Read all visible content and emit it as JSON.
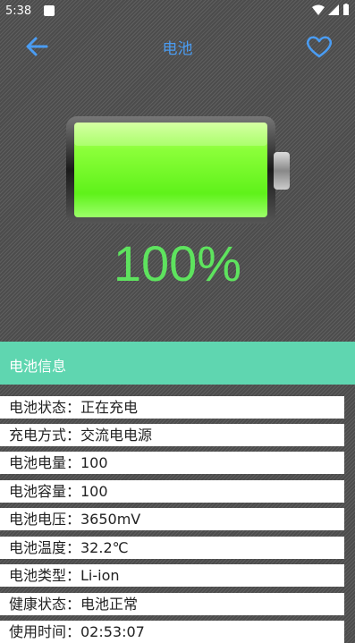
{
  "status_bar": {
    "time": "5:38"
  },
  "app_bar": {
    "title": "电池"
  },
  "battery": {
    "percent_text": "100%",
    "level": 1.0,
    "fill_color": "#5ff21a"
  },
  "info": {
    "header": "电池信息",
    "rows": [
      "电池状态：正在充电",
      "充电方式：交流电电源",
      "电池电量：100",
      "电池容量：100",
      "电池电压：3650mV",
      "电池温度：32.2℃",
      "电池类型：Li-ion",
      "健康状态：电池正常",
      "使用时间：02:53:07"
    ]
  },
  "colors": {
    "accent": "#4a9cf2",
    "header_bg": "#5fd6b0",
    "percent": "#5ee35e"
  }
}
